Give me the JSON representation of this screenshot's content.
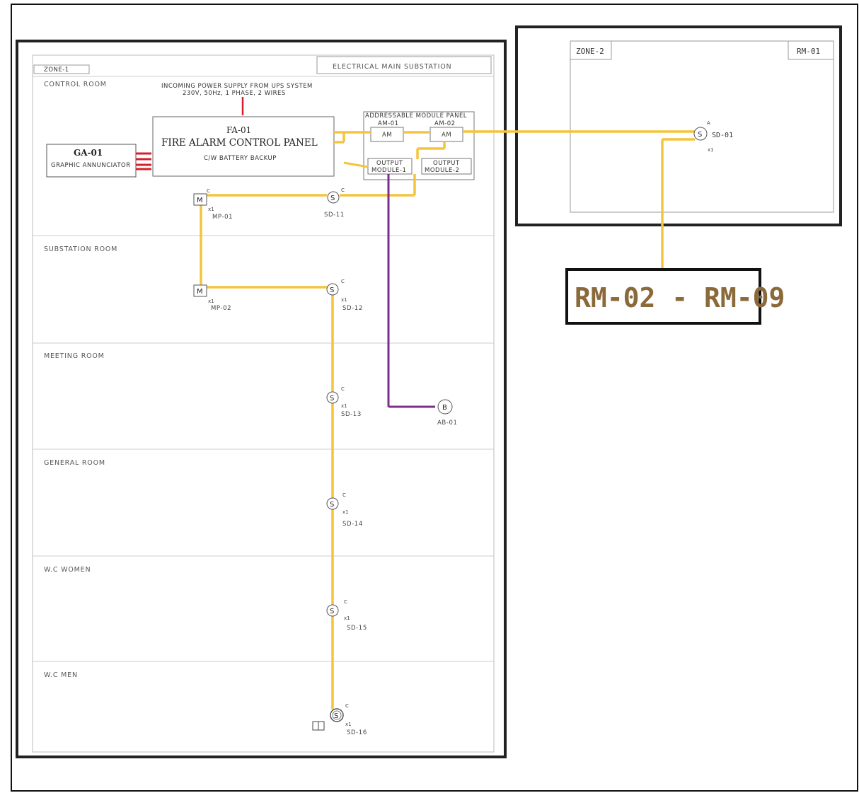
{
  "zone1": {
    "label": "ZONE-1",
    "area_label": "ELECTRICAL MAIN SUBSTATION",
    "rooms": [
      "CONTROL ROOM",
      "SUBSTATION ROOM",
      "MEETING ROOM",
      "GENERAL ROOM",
      "W.C WOMEN",
      "W.C  MEN"
    ]
  },
  "zone2": {
    "label": "ZONE-2",
    "room_tag": "RM-01"
  },
  "power_supply": {
    "line1": "INCOMING POWER SUPPLY FROM UPS SYSTEM",
    "line2": "230V, 50Hz, 1 PHASE, 2 WIRES"
  },
  "panel": {
    "id": "FA-01",
    "name": "FIRE ALARM CONTROL PANEL",
    "sub": "C/W BATTERY BACKUP"
  },
  "annunciator": {
    "id": "GA-01",
    "name": "GRAPHIC ANNUNCIATOR"
  },
  "module_panel": {
    "title": "ADDRESSABLE MODULE PANEL",
    "am1_id": "AM-01",
    "am2_id": "AM-02",
    "am_label": "AM",
    "out1_line1": "OUTPUT",
    "out1_line2": "MODULE-1",
    "out2_line1": "OUTPUT",
    "out2_line2": "MODULE-2"
  },
  "devices": {
    "mp01": "MP-01",
    "mp02": "MP-02",
    "sd01": "SD-01",
    "sd11": "SD-11",
    "sd12": "SD-12",
    "sd13": "SD-13",
    "sd14": "SD-14",
    "sd15": "SD-15",
    "sd16": "SD-16",
    "ab01": "AB-01"
  },
  "symbols": {
    "smoke": "S",
    "manual": "M",
    "bell": "B",
    "sup_c": "C",
    "sup_a": "A",
    "sup_x1": "x1"
  },
  "callout": {
    "text": "RM-02 - RM-09"
  },
  "colors": {
    "loop": "#f5c43c",
    "bell_circuit": "#7b2f8a",
    "power": "#d4202e",
    "callout_text": "#8a6a3b"
  }
}
